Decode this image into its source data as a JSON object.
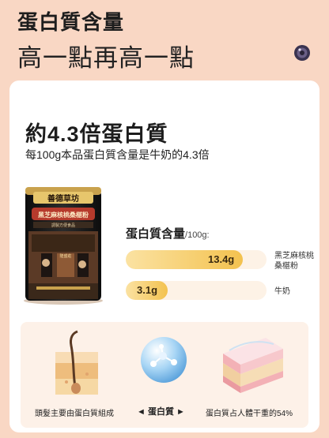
{
  "header": {
    "title": "蛋白質含量",
    "subtitle": "高一點再高一點",
    "icon": "round-badge-icon"
  },
  "main": {
    "headline": "約4.3倍蛋白質",
    "subline": "每100g本品蛋白質含量是牛奶的4.3倍"
  },
  "product": {
    "brand": "善德草坊",
    "name": "黑芝麻核桃桑椹粉",
    "tagline": "調製方便食品",
    "shop_sign": "隆盛莊"
  },
  "comparison": {
    "label": "蛋白質含量",
    "unit": "/100g:",
    "items": [
      {
        "name_line1": "黑芝麻核桃",
        "name_line2": "桑椹粉",
        "value": "13.4g",
        "fraction": 0.83
      },
      {
        "name_line1": "牛奶",
        "name_line2": "",
        "value": "3.1g",
        "fraction": 0.3
      }
    ]
  },
  "bottom": {
    "left_caption": "頭髮主要由蛋白質組成",
    "center_caption": "◄ 蛋白質 ►",
    "right_caption": "蛋白質占人體干重的54%"
  },
  "colors": {
    "background": "#f9d7c4",
    "bar_fill": "#f3c24f",
    "panel": "#fdf1e8"
  }
}
